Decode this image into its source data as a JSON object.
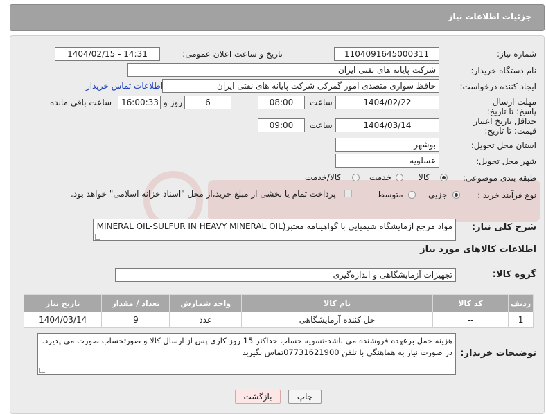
{
  "header": {
    "title": "جزئیات اطلاعات نیاز"
  },
  "fields": {
    "need_number_label": "شماره نیاز:",
    "need_number": "1104091645000311",
    "announce_label": "تاریخ و ساعت اعلان عمومی:",
    "announce_value": "1404/02/15 - 14:31",
    "buyer_org_label": "نام دستگاه خریدار:",
    "buyer_org": "شرکت پایانه های نفتی ایران",
    "creator_label": "ایجاد کننده درخواست:",
    "creator": "حافظ سواری متصدی امور گمرکی شرکت پایانه های نفتی ایران",
    "contact_link": "اطلاعات تماس خریدار",
    "deadline_label": "مهلت ارسال پاسخ: تا تاریخ:",
    "deadline_date": "1404/02/22",
    "time_label": "ساعت",
    "deadline_time": "08:00",
    "days_value": "6",
    "days_label": "روز و",
    "remaining_time": "16:00:33",
    "remaining_label": "ساعت باقی مانده",
    "validity_label": "حداقل تاریخ اعتبار قیمت: تا تاریخ:",
    "validity_date": "1404/03/14",
    "validity_time": "09:00",
    "province_label": "استان محل تحویل:",
    "province": "بوشهر",
    "city_label": "شهر محل تحویل:",
    "city": "عسلویه",
    "category_label": "طبقه بندی موضوعی:",
    "category_options": [
      "کالا",
      "خدمت",
      "کالا/خدمت"
    ],
    "process_label": "نوع فرآیند خرید :",
    "process_options": [
      "جزیی",
      "متوسط"
    ],
    "payment_note": "پرداخت تمام یا بخشی از مبلغ خرید،از محل \"اسناد خزانه اسلامی\" خواهد بود.",
    "desc_label": "شرح کلی نیاز:",
    "desc_value": "مواد مرجع آزمایشگاه شیمیایی با گواهینامه معتبر(HEAVY MINERAL OIL-SULFUR IN HEAVY MINERAL OIL)",
    "goods_info_title": "اطلاعات کالاهای مورد نیاز",
    "goods_group_label": "گروه کالا:",
    "goods_group": "تجهیزات آزمایشگاهی و اندازه‌گیری",
    "buyer_notes_label": "توضیحات خریدار:",
    "buyer_notes_line1": "هزینه حمل برعهده فروشنده می باشد-تسویه حساب حداکثر 15 روز کاری پس از ارسال کالا و صورتحساب صورت می پذیرد.",
    "buyer_notes_line2": "در صورت نیاز به هماهنگی با تلفن 07731621900تماس بگیرید"
  },
  "table": {
    "headers": [
      "ردیف",
      "کد کالا",
      "نام کالا",
      "واحد شمارش",
      "تعداد / مقدار",
      "تاریخ نیاز"
    ],
    "rows": [
      [
        "1",
        "--",
        "حل کننده آزمایشگاهی",
        "عدد",
        "9",
        "1404/03/14"
      ]
    ]
  },
  "buttons": {
    "print": "چاپ",
    "back": "بازگشت"
  },
  "colors": {
    "header_bg": "#a2a2a2",
    "panel_bg": "#ececec",
    "link": "#1a3fb6",
    "back_button_bg": "#fde6e6"
  }
}
